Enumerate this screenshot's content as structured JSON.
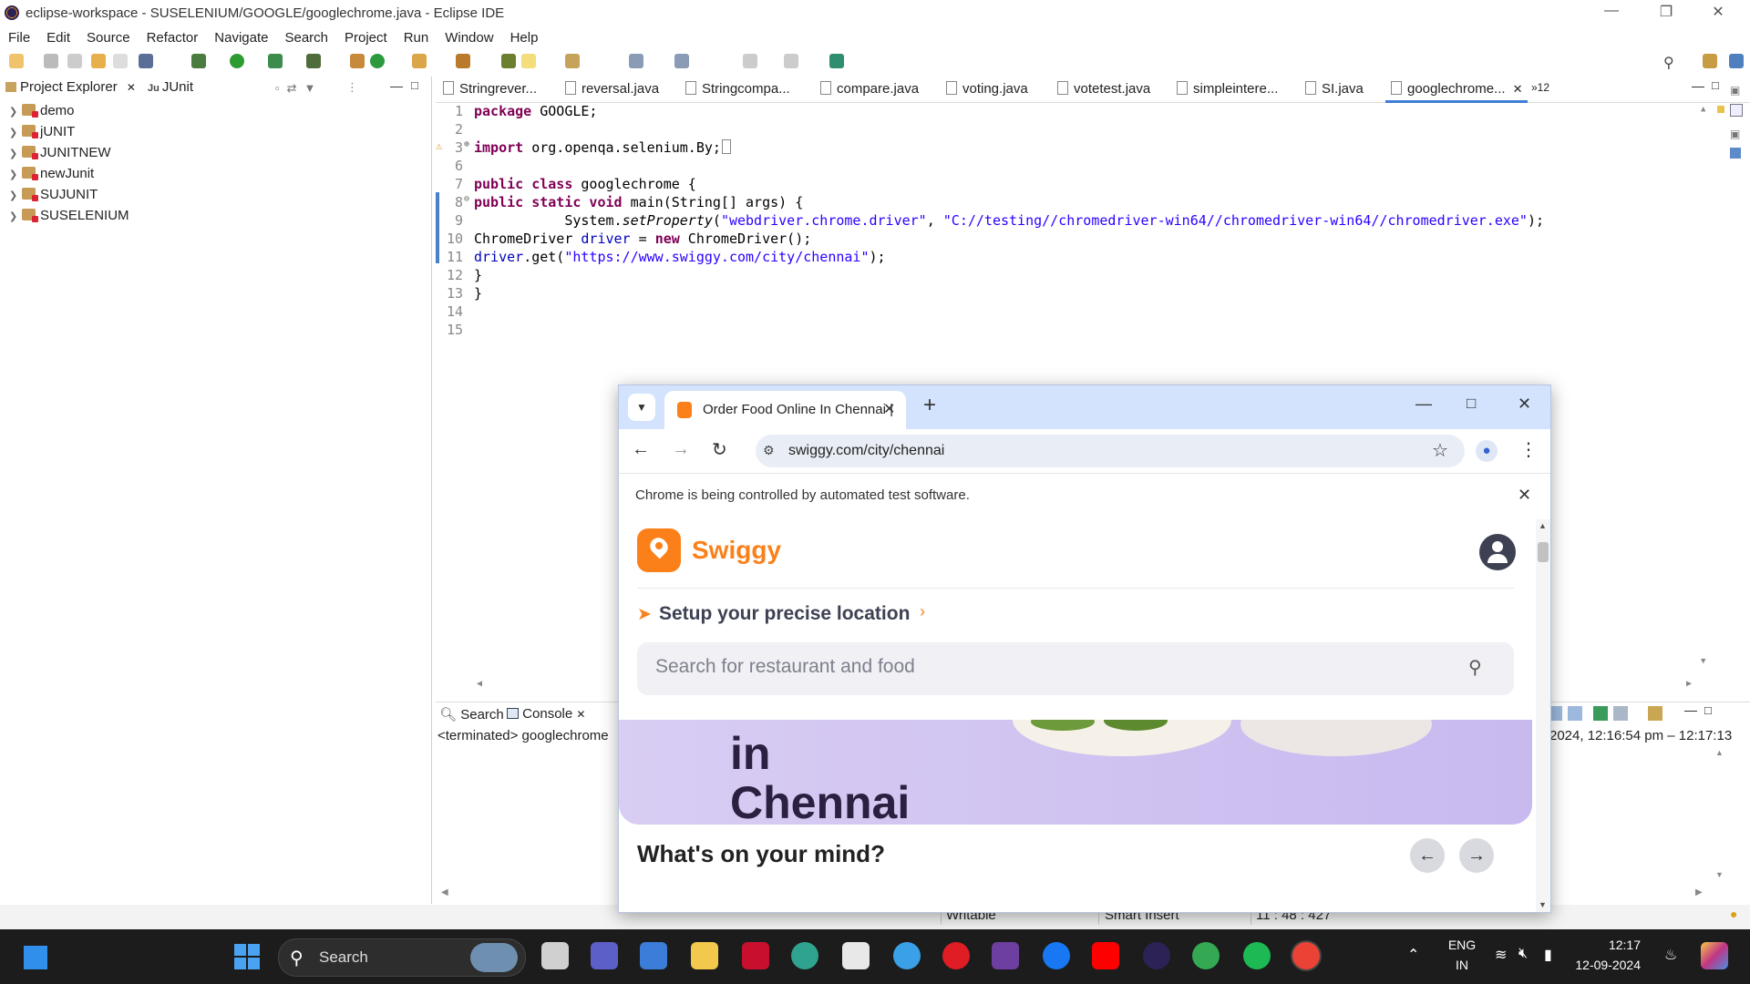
{
  "window": {
    "title": "eclipse-workspace - SUSELENIUM/GOOGLE/googlechrome.java - Eclipse IDE"
  },
  "menu": [
    "File",
    "Edit",
    "Source",
    "Refactor",
    "Navigate",
    "Search",
    "Project",
    "Run",
    "Window",
    "Help"
  ],
  "left_panel": {
    "tabs": [
      "Project Explorer",
      "JUnit"
    ],
    "projects": [
      "demo",
      "jUNIT",
      "JUNITNEW",
      "newJunit",
      "SUJUNIT",
      "SUSELENIUM"
    ]
  },
  "editor": {
    "tabs": [
      "Stringrever...",
      "reversal.java",
      "Stringcompa...",
      "compare.java",
      "voting.java",
      "votetest.java",
      "simpleintere...",
      "SI.java",
      "googlechrome..."
    ],
    "overflow_count": "»12",
    "line_numbers": [
      "1",
      "2",
      "3",
      "6",
      "7",
      "8",
      "9",
      "10",
      "11",
      "12",
      "13",
      "14",
      "15"
    ]
  },
  "code": {
    "l1_kw": "package",
    "l1_rest": " GOOGLE;",
    "l3_kw": "import",
    "l3_rest": " org.openqa.selenium.By;",
    "l7_kw1": "public",
    "l7_kw2": " class",
    "l7_rest": " googlechrome {",
    "l8_kw1": "public",
    "l8_kw2": " static",
    "l8_kw3": " void",
    "l8_rest": " main(String[] args) {",
    "l9_indent": "           System.",
    "l9_method": "setProperty",
    "l9_open": "(",
    "l9_str1": "\"webdriver.chrome.driver\"",
    "l9_comma": ", ",
    "l9_str2": "\"C://testing//chromedriver-win64//chromedriver-win64//chromedriver.exe\"",
    "l9_close": ");",
    "l10_pre": "ChromeDriver ",
    "l10_var": "driver",
    "l10_eq": " = ",
    "l10_kw": "new",
    "l10_rest": " ChromeDriver();",
    "l11_var": "driver",
    "l11_pre": ".get(",
    "l11_str": "\"https://www.swiggy.com/city/chennai\"",
    "l11_rest": ");",
    "l12": "}",
    "l13": "}"
  },
  "console": {
    "tabs": [
      "Search",
      "Console"
    ],
    "terminated": "<terminated> googlechrome",
    "timestamp": "2024, 12:16:54 pm – 12:17:13"
  },
  "statusbar": {
    "writable": "Writable",
    "insert": "Smart Insert",
    "position": "11 : 48 : 427"
  },
  "chrome": {
    "tab_title": "Order Food Online In Chennai |",
    "url": "swiggy.com/city/chennai",
    "infobar": "Chrome is being controlled by automated test software.",
    "page": {
      "brand": "Swiggy",
      "location_prompt": "Setup your precise location",
      "search_placeholder": "Search for restaurant and food",
      "banner_line1": "in",
      "banner_line2": "Chennai",
      "section_title": "What's on your mind?"
    }
  },
  "taskbar": {
    "search_label": "Search",
    "lang1": "ENG",
    "lang2": "IN",
    "time": "12:17",
    "date": "12-09-2024"
  },
  "colors": {
    "swiggy_orange": "#fc8019",
    "eclipse_keyword": "#7f0055",
    "eclipse_string": "#2a00ff",
    "chrome_tabstrip": "#d3e3fd"
  }
}
